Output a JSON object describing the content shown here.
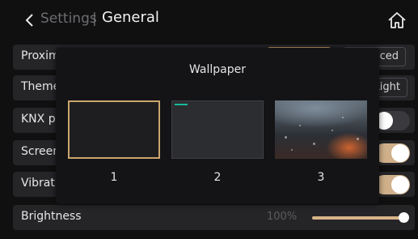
{
  "header": {
    "parent": "Settings",
    "separator": "|",
    "title": "General"
  },
  "rows": [
    {
      "label": "Proximity",
      "option": "Advanced"
    },
    {
      "label": "Theme",
      "option": "Light"
    },
    {
      "label": "KNX p",
      "toggle": false
    },
    {
      "label": "Screen",
      "toggle": true
    },
    {
      "label": "Vibration",
      "toggle": true
    },
    {
      "label": "Brightness",
      "value": "100%",
      "level": 1.0
    }
  ],
  "modal": {
    "title": "Wallpaper",
    "options": [
      {
        "label": "1",
        "selected": true
      },
      {
        "label": "2",
        "selected": false
      },
      {
        "label": "3",
        "selected": false
      }
    ]
  },
  "colors": {
    "accent": "#cfa46a",
    "toggle_on": "#cfb08a",
    "toggle_off": "#3a3a3e",
    "row_bg": "#252528",
    "background": "#101011"
  },
  "icons": {
    "back": "chevron-left-icon",
    "home": "home-icon"
  }
}
